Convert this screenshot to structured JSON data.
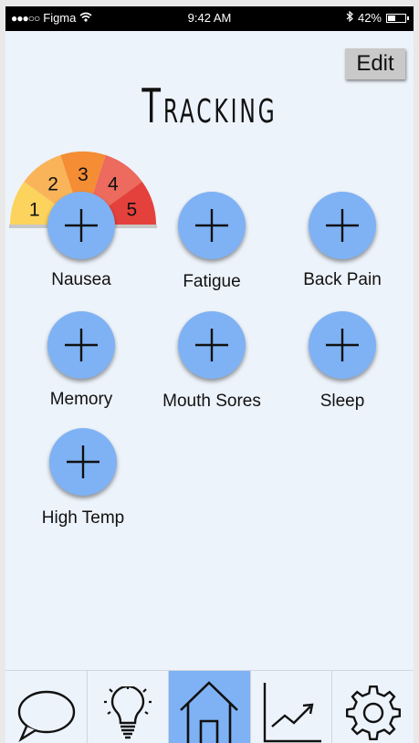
{
  "status_bar": {
    "signal": "●●●○○",
    "carrier": "Figma",
    "time": "9:42 AM",
    "battery": "42%"
  },
  "header": {
    "edit_label": "Edit",
    "title": "Tracking"
  },
  "gauge": {
    "levels": [
      "1",
      "2",
      "3",
      "4",
      "5"
    ],
    "colors": [
      "#fcd35d",
      "#f9b45a",
      "#f48d33",
      "#ec6a5e",
      "#e5413c"
    ]
  },
  "symptoms": [
    {
      "label": "Nausea"
    },
    {
      "label": "Fatigue"
    },
    {
      "label": "Back Pain"
    },
    {
      "label": "Memory"
    },
    {
      "label": "Mouth Sores"
    },
    {
      "label": "Sleep"
    },
    {
      "label": "High Temp"
    }
  ],
  "tabs": [
    {
      "icon": "chat-bubble-icon",
      "active": false
    },
    {
      "icon": "lightbulb-icon",
      "active": false
    },
    {
      "icon": "home-icon",
      "active": true
    },
    {
      "icon": "trend-chart-icon",
      "active": false
    },
    {
      "icon": "gear-icon",
      "active": false
    }
  ],
  "colors": {
    "accent": "#7fb2f4",
    "background": "#edf3fb"
  }
}
